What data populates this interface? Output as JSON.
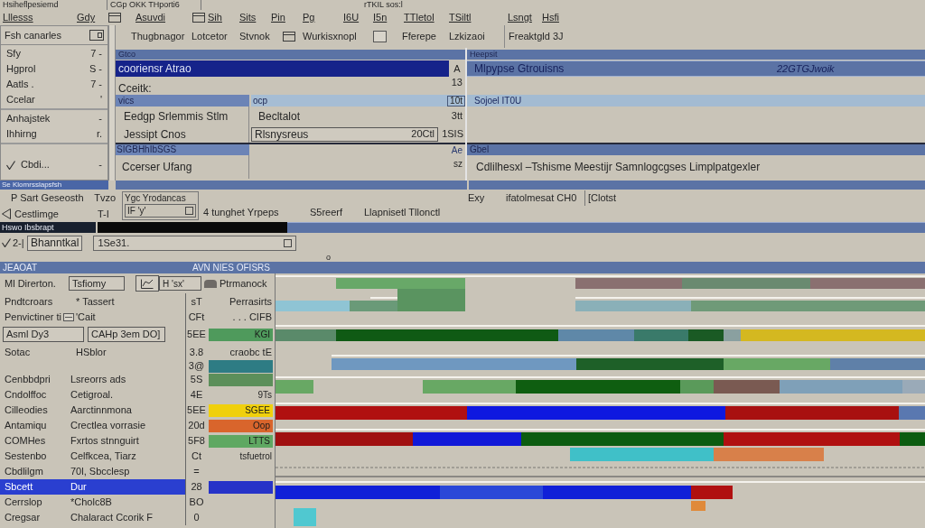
{
  "title_bar": {
    "app": "Hsiheflpesiemd",
    "tab": "CGp OKK THporti6",
    "title": "rTKIL sos:l"
  },
  "menu": [
    {
      "kind": "item",
      "label": "Lllesss"
    },
    {
      "kind": "item",
      "label": "Gdy"
    },
    {
      "kind": "icon"
    },
    {
      "kind": "item",
      "label": "Asuvdi"
    },
    {
      "kind": "icon"
    },
    {
      "kind": "item",
      "label": "Sih"
    },
    {
      "kind": "item",
      "label": "Sits"
    },
    {
      "kind": "item",
      "label": "Pin"
    },
    {
      "kind": "item",
      "label": "Pg"
    },
    {
      "kind": "item",
      "label": "I6U"
    },
    {
      "kind": "item",
      "label": "I5n"
    },
    {
      "kind": "item",
      "label": "TTletol"
    },
    {
      "kind": "item",
      "label": "TSiltl"
    },
    {
      "kind": "item",
      "label": "Lsngt"
    },
    {
      "kind": "item",
      "label": "Hsfi"
    }
  ],
  "sidebar": {
    "header": "Fsh canarles",
    "groups": [
      [
        {
          "label": "Sfy",
          "hint": "7 -"
        },
        {
          "label": "Hgprol",
          "hint": "S -"
        },
        {
          "label": "Aatls .",
          "hint": "7 -"
        },
        {
          "label": "Ccelar",
          "hint": "'"
        }
      ],
      [
        {
          "label": "Anhajstek",
          "hint": "-"
        },
        {
          "label": "Ihhirng",
          "hint": "r."
        }
      ]
    ],
    "footer": {
      "label": "Cbdi...",
      "hint": "-"
    }
  },
  "toolbar": {
    "items": [
      {
        "kind": "button",
        "label": "Thugbnagor"
      },
      {
        "kind": "button",
        "label": "Lotcetor"
      },
      {
        "kind": "button",
        "label": "Stvnok"
      },
      {
        "kind": "icon"
      },
      {
        "kind": "button",
        "label": "Wurkisxnopl"
      },
      {
        "kind": "field"
      },
      {
        "kind": "button",
        "label": "Fferepe"
      },
      {
        "kind": "button",
        "label": "Lzkizaoi"
      }
    ],
    "status": "Freaktgld 3J"
  },
  "list_panel": {
    "header": "Gtco",
    "items": [
      {
        "label": "cooriensr Atrao",
        "badge": "A",
        "selected": true
      }
    ],
    "caption": "Cceitk:",
    "count": "13",
    "table": {
      "columns": [
        "vics",
        "ocp",
        "10t"
      ],
      "rows": [
        {
          "kind": "text",
          "name": "Eedgp Srlemmis Stlm",
          "value": "Becltalot",
          "extra": "3tt"
        },
        {
          "kind": "input",
          "name": "Jessipt Cnos",
          "value": "Rlsnysreus",
          "amount": "20Ctl",
          "extra": "1SIS"
        }
      ]
    },
    "section": {
      "title": "SIGBHhIbSGS",
      "side": "Ae",
      "rows": [
        {
          "name": "Ccerser Ufang",
          "extra": "sz"
        }
      ]
    }
  },
  "detail_panel": {
    "header": "Heepsit",
    "highlight": {
      "label": "Mlpypse Gtrouisns",
      "value": "22GTGJwoik"
    },
    "subheader": "Sojoel IT0U",
    "section": "Gbel",
    "description": "Cdlilhesxl –Tshisme Meestijr Samnlogcgses Limplpatgexler",
    "footer": {
      "label": "Exy",
      "field": "ifatolmesat CH0",
      "link": "[Clotst"
    }
  },
  "status_strip": "Se Klomrsslapsfsh",
  "lower_toolbar": {
    "rows": [
      {
        "kind": "plain",
        "label": "P Sart Geseosth",
        "hint": "Tvzo"
      },
      {
        "kind": "back",
        "label": "Cestlimge",
        "hint": "T-I"
      }
    ],
    "group": {
      "title": "Ygc Yrodancas",
      "field": "IF 'y'"
    },
    "actions": [
      "4 tunghet Yrpeps",
      "S5reerf",
      "Llapnisetl Tllonctl"
    ]
  },
  "address_bar": {
    "label": "Hswo Ibsbrapt"
  },
  "filter": {
    "prefix": "2-|",
    "button": "Bhanntkal",
    "value": "1Se31.",
    "marker": "o"
  },
  "schedule": {
    "header": "JEAOAT",
    "title": "AVN NIES OFISRS",
    "form": [
      {
        "kind": "filter",
        "label": "Ml Direrton.",
        "field": "Tsfiomy",
        "option": "H 'sx'",
        "link": "Ptrmanock"
      },
      {
        "kind": "text",
        "label": "Pndtcroars",
        "value": "* Tassert",
        "code": "sT",
        "note": "Perrasirts"
      },
      {
        "kind": "icon_text",
        "label": "Penvictiner ti",
        "value": "'Cait",
        "code": "CFt",
        "note": ". . . CIFB"
      },
      {
        "kind": "fields",
        "field": "Asml Dy3",
        "field_2": "CAHp 3em DO]",
        "code": "5EE",
        "tag": "KGI",
        "color": "#4f9a5c"
      },
      {
        "kind": "text",
        "label": "Sotac",
        "value": "HSblor",
        "code": "3.8",
        "note": "craobc tE"
      },
      {
        "kind": "swatch",
        "code": "3@",
        "color": "#2e7c84"
      }
    ],
    "rows": [
      {
        "name": "Cenbbdpri",
        "detail": "Lsreorrs ads",
        "code": "5S",
        "color": "#5c8f5a",
        "selected": false
      },
      {
        "name": "Cndolffoc",
        "detail": "Cetigroal.",
        "code": "4E",
        "note": "9Ts",
        "selected": false
      },
      {
        "name": "Cilleodies",
        "detail": "Aarctinnmona",
        "code": "5EE",
        "tag": "SGEE",
        "color": "#f0d00c",
        "selected": false
      },
      {
        "name": "Antamiqu",
        "detail": "Crectlea vorrasie",
        "code": "20d",
        "tag": "Oop",
        "color": "#d9652c",
        "selected": false
      },
      {
        "name": "COMHes",
        "detail": "Fxrtos stnnguirt",
        "code": "5F8",
        "tag": "LTTS",
        "color": "#5fa862",
        "selected": false
      },
      {
        "name": "Sestenbo",
        "detail": "Celfkcea, Tiarz",
        "code": "Ct",
        "note": "tsfuetrol",
        "selected": false
      },
      {
        "name": "Cbdlilgm",
        "detail": "70l, Sbcclesp",
        "code": "=",
        "selected": false
      },
      {
        "name": "Sbcett",
        "detail": "Dur",
        "code": "28",
        "color": "#2633c8",
        "selected": true
      },
      {
        "name": "Cerrslop",
        "detail": "*Cholc8B",
        "code": "BO",
        "selected": false
      },
      {
        "name": "Cregsar",
        "detail": "Chalaract Ccorik F",
        "code": "0",
        "selected": false
      }
    ]
  }
}
